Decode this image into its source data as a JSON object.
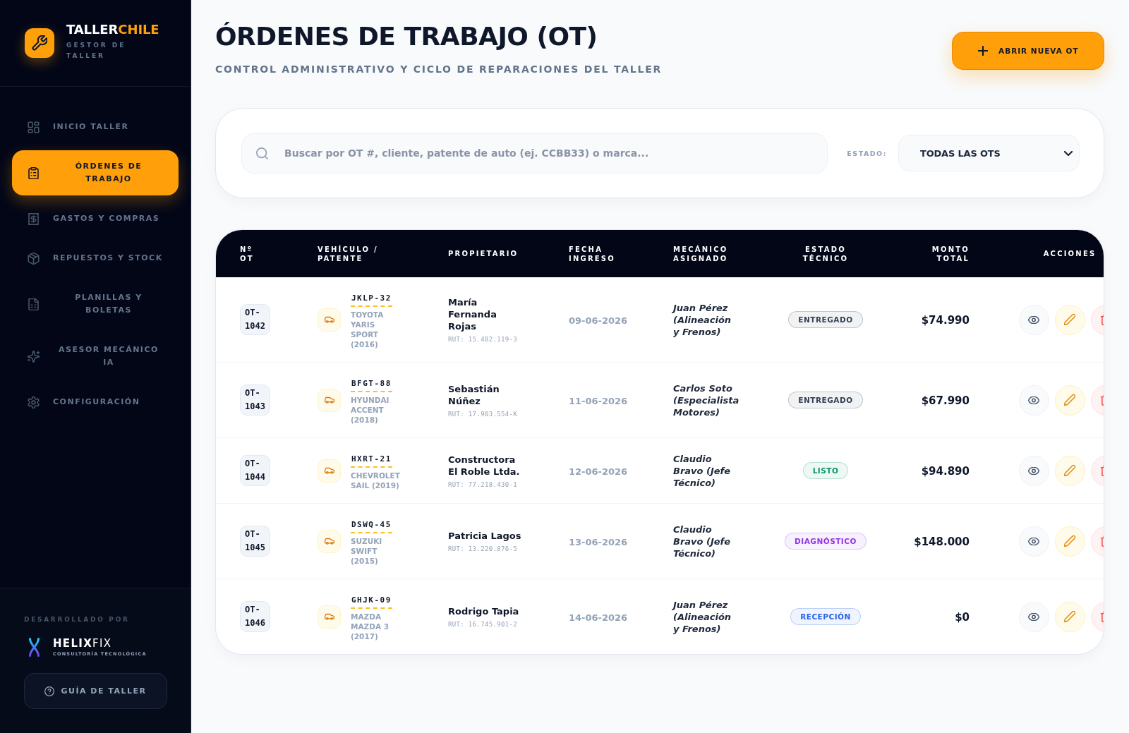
{
  "sidebar": {
    "brand": {
      "name": "TALLER",
      "accent": "CHILE",
      "tagline": "GESTOR DE TALLER"
    },
    "nav_items": [
      {
        "label": "INICIO TALLER",
        "selected": false
      },
      {
        "label": "ÓRDENES DE TRABAJO",
        "selected": true
      },
      {
        "label": "GASTOS Y COMPRAS",
        "selected": false
      },
      {
        "label": "REPUESTOS Y STOCK",
        "selected": false
      },
      {
        "label": "PLANILLAS Y BOLETAS",
        "selected": false
      },
      {
        "label": "ASESOR MECÁNICO IA",
        "selected": false
      },
      {
        "label": "CONFIGURACIÓN",
        "selected": false
      }
    ],
    "footer": {
      "caption": "DESARROLLADO POR",
      "company": "**HELIX**FIX",
      "company_tagline": "CONSULTORÍA TECNOLÓGICA",
      "guide_button": "GUÍA DE TALLER"
    }
  },
  "header": {
    "title": "ÓRDENES DE TRABAJO (OT)",
    "subtitle": "CONTROL ADMINISTRATIVO Y CICLO DE REPARACIONES DEL TALLER",
    "new_button": "ABRIR NUEVA OT"
  },
  "filters": {
    "search": {
      "placeholder": "Buscar por OT #, cliente, patente de auto (ej. CCBB33) o marca..."
    },
    "status_filter": {
      "label": "ESTADO:",
      "value": "TODAS LAS OTS"
    }
  },
  "table": {
    "columns": [
      "Nº OT",
      "VEHÍCULO / PATENTE",
      "PROPIETARIO",
      "FECHA INGRESO",
      "MECÁNICO ASIGNADO",
      "ESTADO TÉCNICO",
      "MONTO TOTAL",
      "ACCIONES"
    ],
    "rows": [
      {
        "ot": "OT-1042",
        "plate": "JKLP-32",
        "vehicle": "TOYOTA YARIS SPORT (2016)",
        "owner": "María Fernanda Rojas",
        "rut": "RUT: 15.482.119-3",
        "entry_date": "09-06-2026",
        "mechanic": "Juan Pérez (Alineación y Frenos)",
        "status": {
          "label": "ENTREGADO",
          "color": "#334155"
        },
        "total": "$74.990"
      },
      {
        "ot": "OT-1043",
        "plate": "BFGT-88",
        "vehicle": "HYUNDAI ACCENT (2018)",
        "owner": "Sebastián Núñez",
        "rut": "RUT: 17.903.554-K",
        "entry_date": "11-06-2026",
        "mechanic": "Carlos Soto (Especialista Motores)",
        "status": {
          "label": "ENTREGADO",
          "color": "#334155"
        },
        "total": "$67.990"
      },
      {
        "ot": "OT-1044",
        "plate": "HXRT-21",
        "vehicle": "CHEVROLET SAIL (2019)",
        "owner": "Constructora El Roble Ltda.",
        "rut": "RUT: 77.218.430-1",
        "entry_date": "12-06-2026",
        "mechanic": "Claudio Bravo (Jefe Técnico)",
        "status": {
          "label": "LISTO",
          "color": "#059669"
        },
        "total": "$94.890"
      },
      {
        "ot": "OT-1045",
        "plate": "DSWQ-45",
        "vehicle": "SUZUKI SWIFT (2015)",
        "owner": "Patricia Lagos",
        "rut": "RUT: 13.220.876-5",
        "entry_date": "13-06-2026",
        "mechanic": "Claudio Bravo (Jefe Técnico)",
        "status": {
          "label": "DIAGNÓSTICO",
          "color": "#9333ea"
        },
        "total": "$148.000"
      },
      {
        "ot": "OT-1046",
        "plate": "GHJK-09",
        "vehicle": "MAZDA MAZDA 3 (2017)",
        "owner": "Rodrigo Tapia",
        "rut": "RUT: 16.745.901-2",
        "entry_date": "14-06-2026",
        "mechanic": "Juan Pérez (Alineación y Frenos)",
        "status": {
          "label": "RECEPCIÓN",
          "color": "#2563eb"
        },
        "total": "$0"
      }
    ]
  }
}
